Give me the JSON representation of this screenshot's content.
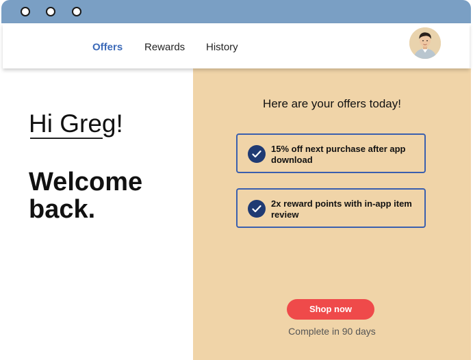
{
  "colors": {
    "titlebar": "#7a9fc4",
    "accent_nav": "#3b69b8",
    "offers_panel": "#f0d4a8",
    "card_border": "#3a5fae",
    "check_fill": "#1f3a73",
    "cta": "#ef4a4a"
  },
  "window": {
    "controls": [
      "window-dot-1",
      "window-dot-2",
      "window-dot-3"
    ]
  },
  "nav": {
    "items": [
      {
        "label": "Offers",
        "active": true
      },
      {
        "label": "Rewards",
        "active": false
      },
      {
        "label": "History",
        "active": false
      }
    ],
    "avatar_icon": "user-avatar"
  },
  "greeting": {
    "hello": "Hi Greg!",
    "welcome": "Welcome back."
  },
  "offers": {
    "heading": "Here are your offers today!",
    "items": [
      {
        "text": "15% off next purchase after app download",
        "icon": "checkmark-icon"
      },
      {
        "text": "2x reward points with in-app item review",
        "icon": "checkmark-icon"
      }
    ]
  },
  "cta": {
    "label": "Shop now",
    "note": "Complete in 90 days"
  }
}
